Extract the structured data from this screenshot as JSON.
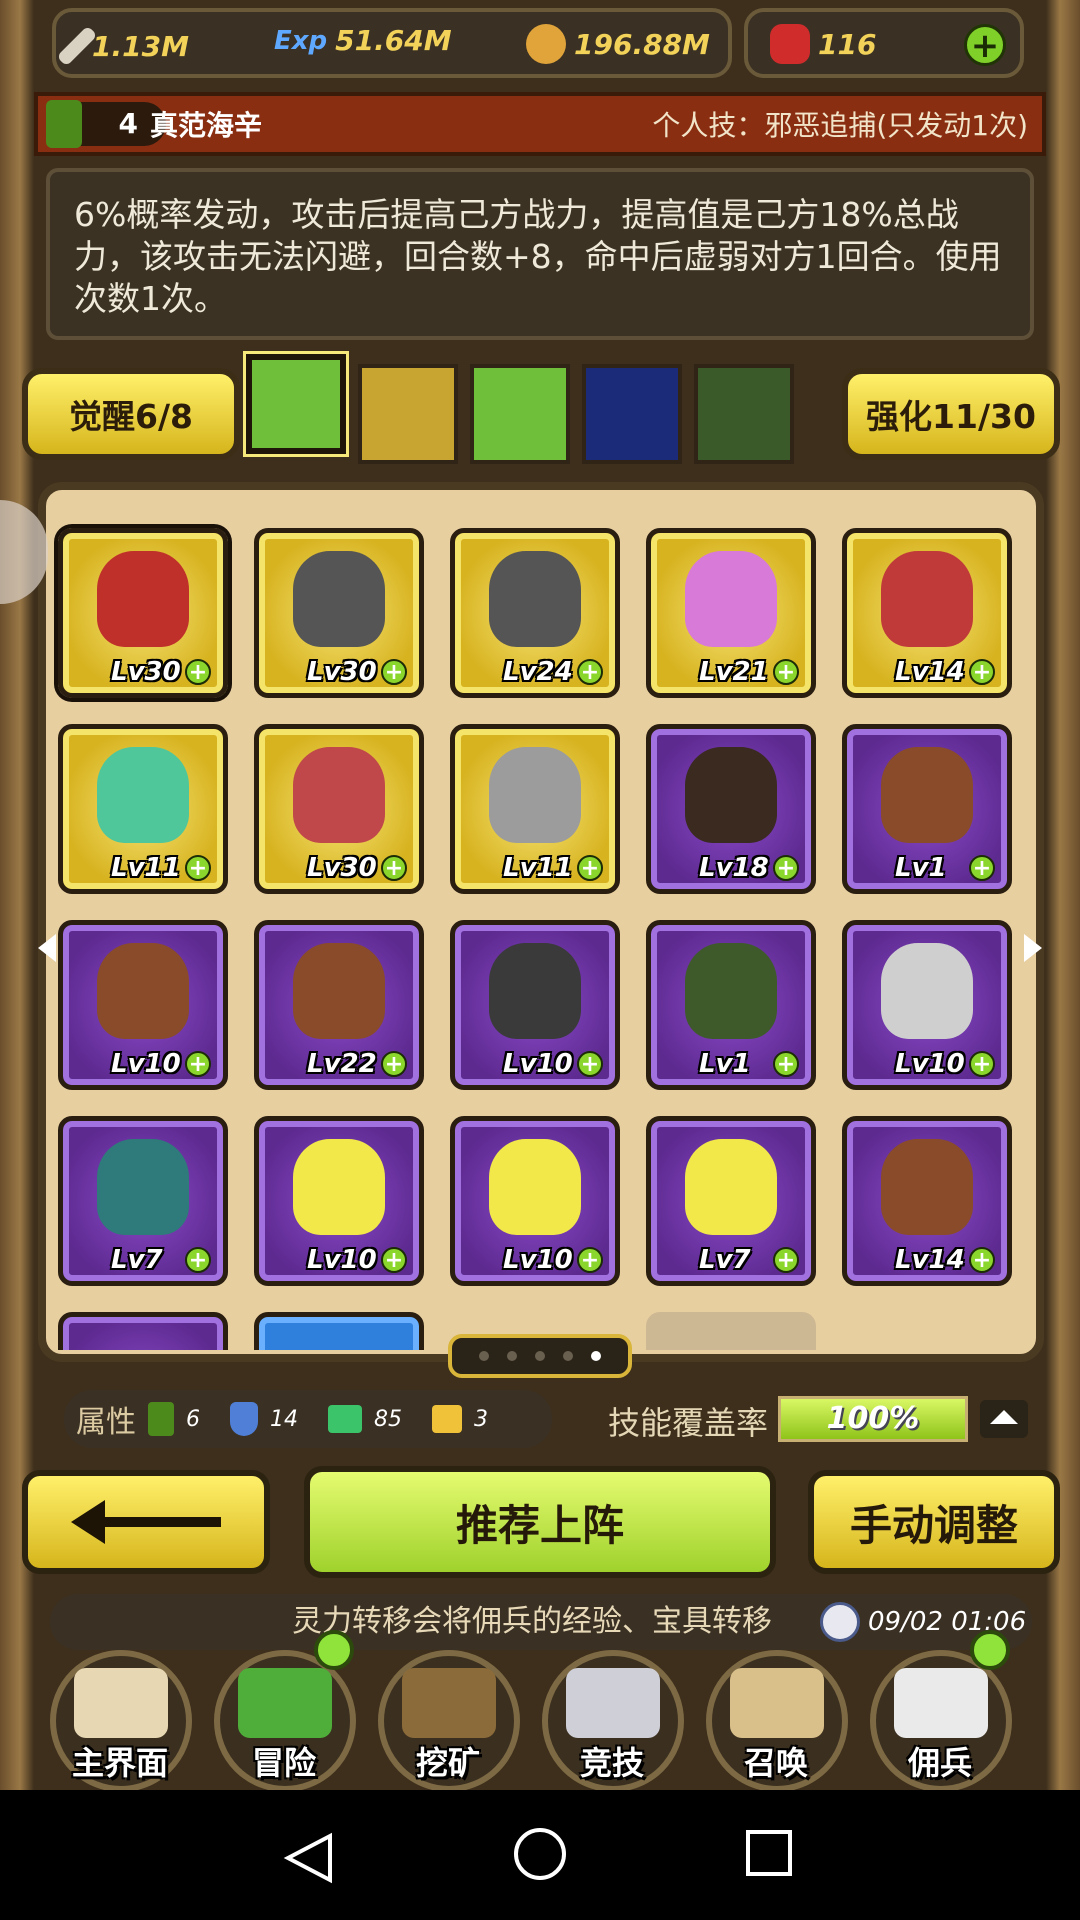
{
  "resources": {
    "attack": {
      "icon": "sword-icon",
      "value": "1.13M"
    },
    "exp": {
      "icon": "exp-icon",
      "label": "Exp",
      "value": "51.64M"
    },
    "gold": {
      "icon": "gold-coin-icon",
      "value": "196.88M"
    },
    "gems": {
      "icon": "red-gem-icon",
      "value": "116"
    },
    "add_icon": "plus-icon"
  },
  "hero": {
    "level": "4",
    "name": "真范海辛",
    "skill_label": "个人技：邪恶追捕(只发动1次)",
    "skill_description": "6%概率发动，攻击后提高己方战力，提高值是己方18%总战力，该攻击无法闪避，回合数+8，命中后虚弱对方1回合。使用次数1次。"
  },
  "tabs": {
    "awaken_label": "觉醒6/8",
    "enhance_label": "强化11/30",
    "items": [
      {
        "icon": "holy-cross-icon",
        "selected": true
      },
      {
        "icon": "crown-up-icon",
        "selected": false
      },
      {
        "icon": "holy-cross-handshake-icon",
        "selected": false
      },
      {
        "icon": "crossbow-icon",
        "selected": false
      },
      {
        "icon": "scroll-bundle-icon",
        "selected": false
      }
    ]
  },
  "mercenaries": [
    {
      "level": "Lv30",
      "rarity": "gold",
      "color": "#c0302a",
      "selected": true
    },
    {
      "level": "Lv30",
      "rarity": "gold",
      "color": "#555555"
    },
    {
      "level": "Lv24",
      "rarity": "gold",
      "color": "#555555"
    },
    {
      "level": "Lv21",
      "rarity": "gold",
      "color": "#d77ad8"
    },
    {
      "level": "Lv14",
      "rarity": "gold",
      "color": "#c13a3a"
    },
    {
      "level": "Lv11",
      "rarity": "gold",
      "color": "#4fc79a"
    },
    {
      "level": "Lv30",
      "rarity": "gold",
      "color": "#c0474a"
    },
    {
      "level": "Lv11",
      "rarity": "gold",
      "color": "#9c9c9c"
    },
    {
      "level": "Lv18",
      "rarity": "purple",
      "color": "#3a2a20"
    },
    {
      "level": "Lv1",
      "rarity": "purple",
      "color": "#8a4b2a"
    },
    {
      "level": "Lv10",
      "rarity": "purple",
      "color": "#8a4b2a"
    },
    {
      "level": "Lv22",
      "rarity": "purple",
      "color": "#8a4b2a"
    },
    {
      "level": "Lv10",
      "rarity": "purple",
      "color": "#3a3a3a"
    },
    {
      "level": "Lv1",
      "rarity": "purple",
      "color": "#3f5a2a"
    },
    {
      "level": "Lv10",
      "rarity": "purple",
      "color": "#cfcfcf"
    },
    {
      "level": "Lv7",
      "rarity": "purple",
      "color": "#2f7a7a"
    },
    {
      "level": "Lv10",
      "rarity": "purple",
      "color": "#f2e84a"
    },
    {
      "level": "Lv10",
      "rarity": "purple",
      "color": "#f2e84a"
    },
    {
      "level": "Lv7",
      "rarity": "purple",
      "color": "#f2e84a"
    },
    {
      "level": "Lv14",
      "rarity": "purple",
      "color": "#8a4b2a"
    }
  ],
  "pagination": {
    "current": 5,
    "total": 5
  },
  "attributes": {
    "label": "属性",
    "sword": "6",
    "shield": "14",
    "boot": "85",
    "crown": "3"
  },
  "skill_coverage": {
    "label": "技能覆盖率",
    "value": "100%",
    "fraction": 1.0
  },
  "buttons": {
    "recommend": "推荐上阵",
    "manual": "手动调整"
  },
  "tip": {
    "text": "灵力转移会将佣兵的经验、宝具转移",
    "time": "09/02 01:06"
  },
  "nav": [
    {
      "label": "主界面",
      "icon": "map-scroll-icon",
      "dot": false
    },
    {
      "label": "冒险",
      "icon": "island-icon",
      "dot": true
    },
    {
      "label": "挖矿",
      "icon": "pickaxe-icon",
      "dot": false
    },
    {
      "label": "竞技",
      "icon": "crossed-swords-icon",
      "dot": false
    },
    {
      "label": "召唤",
      "icon": "summon-scroll-icon",
      "dot": false
    },
    {
      "label": "佣兵",
      "icon": "tent-icon",
      "dot": true
    }
  ]
}
